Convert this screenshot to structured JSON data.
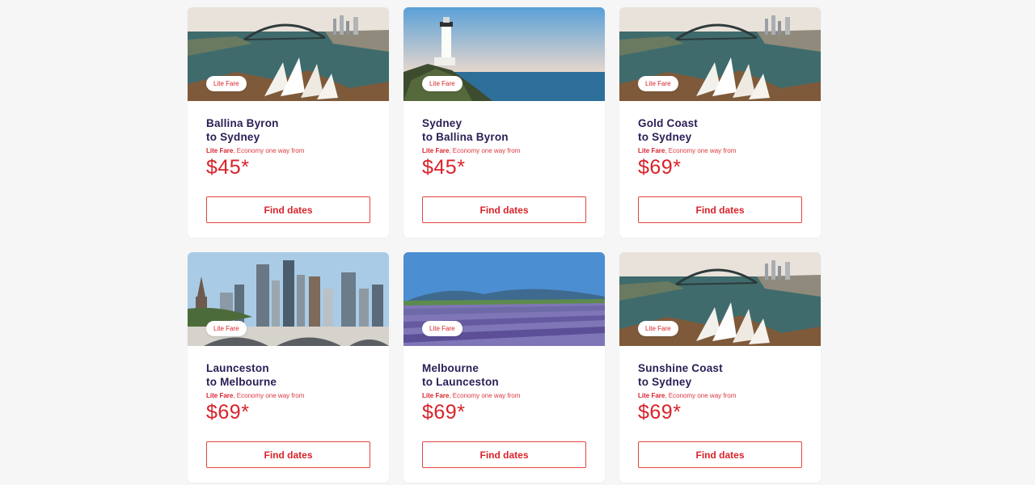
{
  "colors": {
    "accent": "#d8232a",
    "route_text": "#2b1d55",
    "background": "#f6f6f7"
  },
  "cards": [
    {
      "image": "sydney-harbour-image",
      "badge": "Lite Fare",
      "from": "Ballina Byron",
      "to": "to Sydney",
      "fare_type": "Lite Fare",
      "fare_desc": ", Economy one way from",
      "price": "$45*",
      "button": "Find dates"
    },
    {
      "image": "lighthouse-image",
      "badge": "Lite Fare",
      "from": "Sydney",
      "to": "to Ballina Byron",
      "fare_type": "Lite Fare",
      "fare_desc": ", Economy one way from",
      "price": "$45*",
      "button": "Find dates"
    },
    {
      "image": "sydney-harbour-image",
      "badge": "Lite Fare",
      "from": "Gold Coast",
      "to": "to Sydney",
      "fare_type": "Lite Fare",
      "fare_desc": ", Economy one way from",
      "price": "$69*",
      "button": "Find dates"
    },
    {
      "image": "city-skyline-image",
      "badge": "Lite Fare",
      "from": "Launceston",
      "to": "to Melbourne",
      "fare_type": "Lite Fare",
      "fare_desc": ", Economy one way from",
      "price": "$69*",
      "button": "Find dates"
    },
    {
      "image": "lavender-field-image",
      "badge": "Lite Fare",
      "from": "Melbourne",
      "to": "to Launceston",
      "fare_type": "Lite Fare",
      "fare_desc": ", Economy one way from",
      "price": "$69*",
      "button": "Find dates"
    },
    {
      "image": "sydney-harbour-image",
      "badge": "",
      "from": "Sunshine Coast",
      "to": "to Sydney",
      "fare_type": "Lite Fare",
      "fare_desc": ", Economy one way from",
      "price": "$69*",
      "button": "Find dates"
    }
  ]
}
